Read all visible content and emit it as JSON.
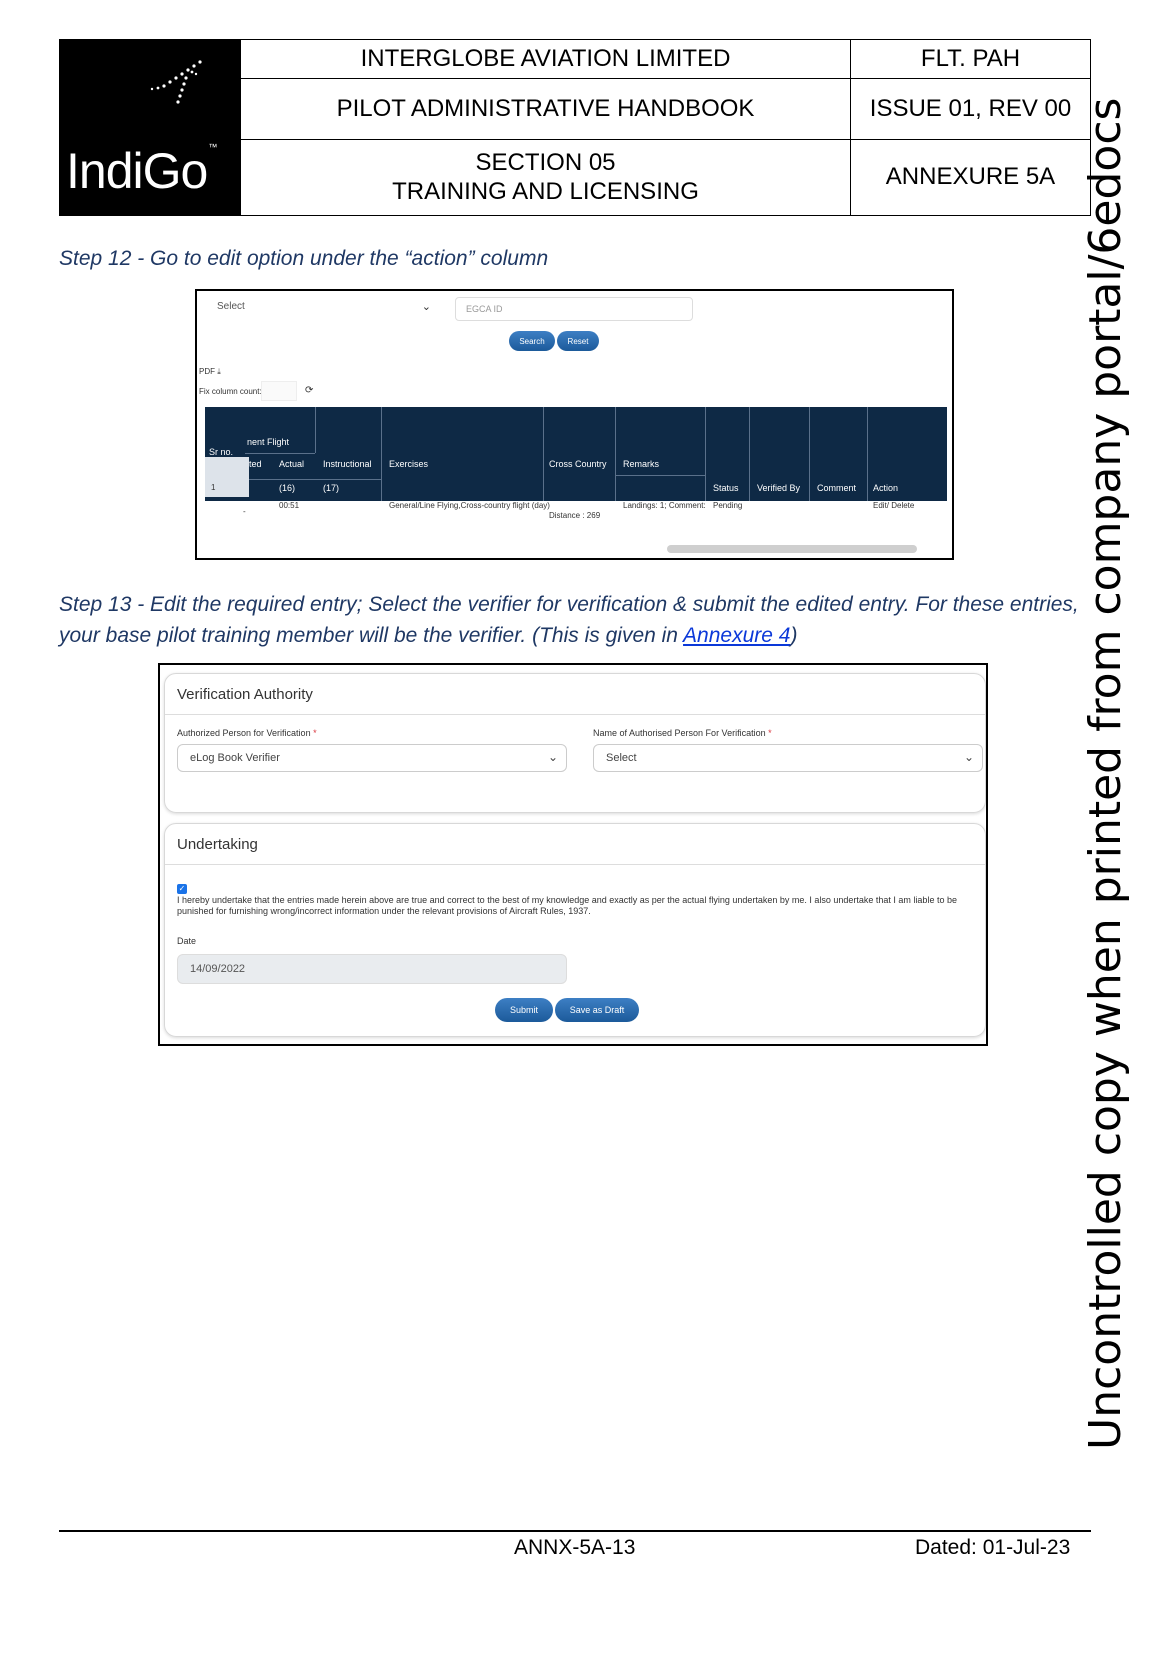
{
  "header": {
    "logo_text": "IndiGo",
    "logo_tm": "™",
    "company": "INTERGLOBE AVIATION LIMITED",
    "doc_code": "FLT. PAH",
    "handbook": "PILOT ADMINISTRATIVE HANDBOOK",
    "issue": "ISSUE 01, REV 00",
    "section_line1": "SECTION 05",
    "section_line2": "TRAINING AND LICENSING",
    "annexure": "ANNEXURE 5A"
  },
  "watermark": "Uncontrolled copy when printed from company portal/6edocs",
  "step12": "Step 12 - Go to edit option under the “action” column",
  "step13": {
    "text": "Step 13 - Edit the required entry; Select the verifier for verification & submit the edited entry. For these entries, your base pilot training member will be the verifier. (This is given in ",
    "link": "Annexure 4",
    "tail": ")"
  },
  "shot1": {
    "select_value": "Select",
    "egca_placeholder": "EGCA ID",
    "search_btn": "Search",
    "reset_btn": "Reset",
    "pdf_label": "PDF",
    "fix_col_label": "Fix column count:",
    "headers": {
      "group": "nent Flight",
      "srno": "Sr no.",
      "ited": "ited",
      "actual": "Actual",
      "instructional": "Instructional",
      "exercises": "Exercises",
      "cross_country": "Cross Country",
      "remarks": "Remarks",
      "status": "Status",
      "verified_by": "Verified By",
      "comment": "Comment",
      "action": "Action",
      "c16": "(16)",
      "c17": "(17)"
    },
    "row": {
      "srno": "1",
      "dash": "-",
      "actual": "00:51",
      "exercises": "General/Line Flying,Cross-country flight (day)",
      "cross_country": "Distance : 269",
      "remarks": "Landings: 1; Comment:",
      "status": "Pending",
      "action": "Edit/ Delete"
    }
  },
  "shot2": {
    "verification_title": "Verification Authority",
    "auth_label": "Authorized Person for Verification",
    "auth_value": "eLog Book Verifier",
    "name_label": "Name of Authorised Person For Verification",
    "name_value": "Select",
    "required_mark": "*",
    "undertaking_title": "Undertaking",
    "undertaking_text": "I hereby undertake that the entries made herein above are true and correct to the best of my knowledge and exactly as per the actual flying undertaken by me. I also undertake that I am liable to be punished for furnishing wrong/incorrect information under the relevant provisions of Aircraft Rules, 1937.",
    "date_label": "Date",
    "date_value": "14/09/2022",
    "submit_btn": "Submit",
    "draft_btn": "Save as Draft"
  },
  "footer": {
    "page_id": "ANNX-5A-13",
    "dated": "Dated: 01-Jul-23"
  }
}
